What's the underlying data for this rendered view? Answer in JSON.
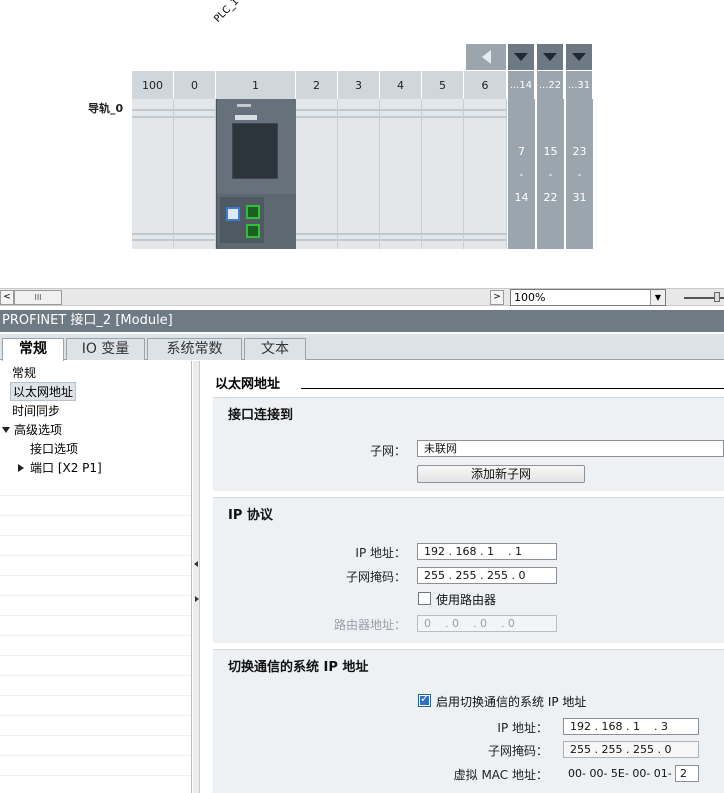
{
  "rack": {
    "plc_label": "PLC_1",
    "rail_label": "导轨_0",
    "slots": [
      "100",
      "0",
      "1",
      "2",
      "3",
      "4",
      "5",
      "6"
    ],
    "groups": [
      {
        "header": "...14",
        "from": "7",
        "dash": "-",
        "to": "14"
      },
      {
        "header": "...22",
        "from": "15",
        "dash": "-",
        "to": "22"
      },
      {
        "header": "...31",
        "from": "23",
        "dash": "-",
        "to": "31"
      }
    ]
  },
  "toolbar": {
    "scroll_left": "<",
    "scroll_thumb": "III",
    "scroll_right": ">",
    "zoom": "100%",
    "zoom_arrow": "▼"
  },
  "panel": {
    "title": "PROFINET 接口_2 [Module]",
    "tabs": [
      "常规",
      "IO 变量",
      "系统常数",
      "文本"
    ],
    "tree": {
      "general": "常规",
      "ethernet": "以太网地址",
      "time_sync": "时间同步",
      "advanced": "高级选项",
      "interface_options": "接口选项",
      "port": "端口 [X2 P1]"
    }
  },
  "ethernet": {
    "heading": "以太网地址",
    "connect": {
      "title": "接口连接到",
      "subnet_label": "子网：",
      "subnet_value": "未联网",
      "add_subnet_button": "添加新子网"
    },
    "ip": {
      "title": "IP 协议",
      "ip_label": "IP 地址：",
      "ip_value": "192 . 168 . 1    . 1",
      "mask_label": "子网掩码：",
      "mask_value": "255 . 255 . 255 . 0",
      "use_router_label": "使用路由器",
      "router_label": "路由器地址：",
      "router_value": "0    . 0    . 0    . 0"
    },
    "switchover": {
      "title": "切换通信的系统 IP 地址",
      "enable_label": "启用切换通信的系统 IP 地址",
      "ip_label": "IP 地址：",
      "ip_value": "192 . 168 . 1    . 3",
      "mask_label": "子网掩码：",
      "mask_value": "255 . 255 . 255 . 0",
      "mac_label": "虚拟 MAC 地址：",
      "mac_prefix": "00- 00- 5E- 00- 01-",
      "mac_last": "2"
    }
  }
}
